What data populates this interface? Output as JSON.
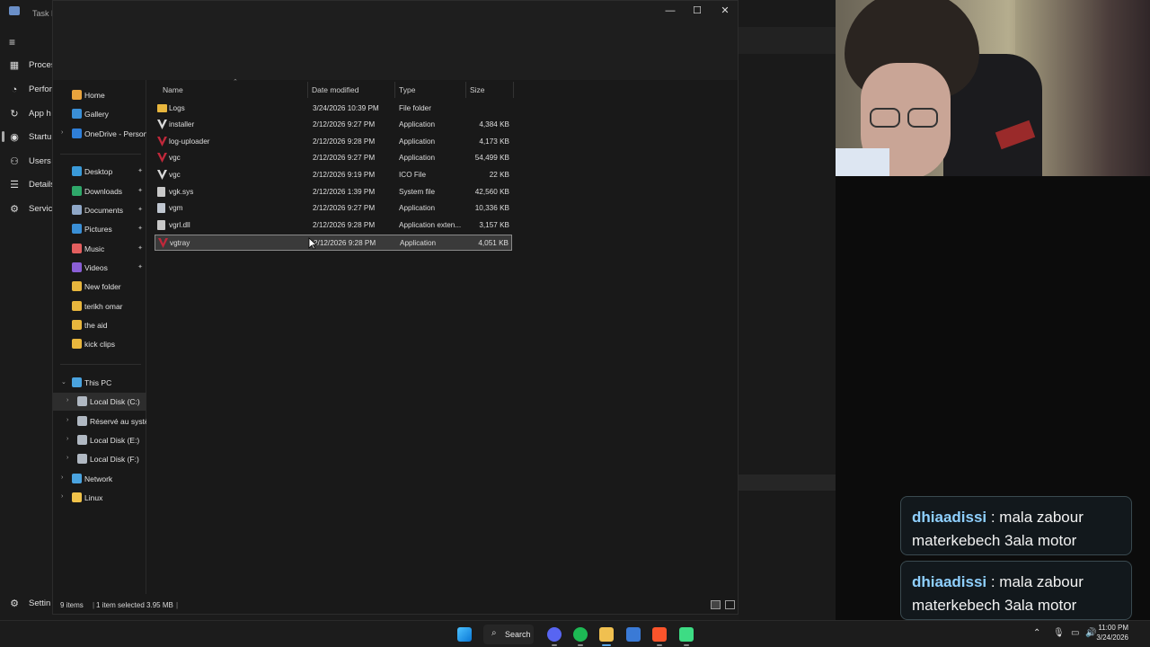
{
  "task_manager": {
    "title": "Task M",
    "nav": [
      {
        "label": "Proces",
        "icon": "processes-icon"
      },
      {
        "label": "Perfor",
        "icon": "performance-icon"
      },
      {
        "label": "App h",
        "icon": "app-history-icon"
      },
      {
        "label": "Startu",
        "icon": "startup-icon"
      },
      {
        "label": "Users",
        "icon": "users-icon"
      },
      {
        "label": "Details",
        "icon": "details-icon"
      },
      {
        "label": "Servic",
        "icon": "services-icon"
      }
    ],
    "settings_label": "Settin"
  },
  "explorer": {
    "window_controls": {
      "minimize": "—",
      "maximize": "☐",
      "close": "✕"
    },
    "nav_pane": {
      "quick": [
        {
          "label": "Home",
          "icon": "home-icon",
          "color": "#e8a33d"
        },
        {
          "label": "Gallery",
          "icon": "gallery-icon",
          "color": "#3a8fd6"
        },
        {
          "label": "OneDrive - Persona",
          "icon": "onedrive-icon",
          "color": "#2f7fd8"
        }
      ],
      "pinned": [
        {
          "label": "Desktop",
          "icon": "desktop-icon",
          "color": "#3a9ad9"
        },
        {
          "label": "Downloads",
          "icon": "downloads-icon",
          "color": "#2fa86a"
        },
        {
          "label": "Documents",
          "icon": "documents-icon",
          "color": "#8fa7c7"
        },
        {
          "label": "Pictures",
          "icon": "pictures-icon",
          "color": "#3a8fd6"
        },
        {
          "label": "Music",
          "icon": "music-icon",
          "color": "#e35f5f"
        },
        {
          "label": "Videos",
          "icon": "videos-icon",
          "color": "#8a5fd6"
        },
        {
          "label": "New folder",
          "icon": "folder-icon",
          "color": "#e8b63d"
        },
        {
          "label": "terikh omar",
          "icon": "folder-icon",
          "color": "#e8b63d"
        },
        {
          "label": "the aid",
          "icon": "folder-icon",
          "color": "#e8b63d"
        },
        {
          "label": "kick clips",
          "icon": "folder-icon",
          "color": "#e8b63d"
        }
      ],
      "this_pc": {
        "label": "This PC",
        "icon": "this-pc-icon"
      },
      "drives": [
        {
          "label": "Local Disk (C:)",
          "icon": "drive-icon"
        },
        {
          "label": "Réservé au systèr",
          "icon": "drive-icon"
        },
        {
          "label": "Local Disk (E:)",
          "icon": "drive-icon"
        },
        {
          "label": "Local Disk (F:)",
          "icon": "drive-icon"
        }
      ],
      "network": {
        "label": "Network",
        "icon": "network-icon"
      },
      "linux": {
        "label": "Linux",
        "icon": "linux-icon"
      }
    },
    "columns": {
      "name": "Name",
      "date": "Date modified",
      "type": "Type",
      "size": "Size"
    },
    "files": [
      {
        "name": "Logs",
        "date": "3/24/2026 10:39 PM",
        "type": "File folder",
        "size": "",
        "icon": "folder-icon"
      },
      {
        "name": "installer",
        "date": "2/12/2026 9:27 PM",
        "type": "Application",
        "size": "4,384 KB",
        "icon": "vanguard-app-icon"
      },
      {
        "name": "log-uploader",
        "date": "2/12/2026 9:28 PM",
        "type": "Application",
        "size": "4,173 KB",
        "icon": "vanguard-red-icon"
      },
      {
        "name": "vgc",
        "date": "2/12/2026 9:27 PM",
        "type": "Application",
        "size": "54,499 KB",
        "icon": "vanguard-red-icon"
      },
      {
        "name": "vgc",
        "date": "2/12/2026 9:19 PM",
        "type": "ICO File",
        "size": "22 KB",
        "icon": "vanguard-app-icon"
      },
      {
        "name": "vgk.sys",
        "date": "2/12/2026 1:39 PM",
        "type": "System file",
        "size": "42,560 KB",
        "icon": "system-file-icon"
      },
      {
        "name": "vgm",
        "date": "2/12/2026 9:27 PM",
        "type": "Application",
        "size": "10,336 KB",
        "icon": "app-window-icon"
      },
      {
        "name": "vgrl.dll",
        "date": "2/12/2026 9:28 PM",
        "type": "Application exten...",
        "size": "3,157 KB",
        "icon": "dll-file-icon"
      },
      {
        "name": "vgtray",
        "date": "2/12/2026 9:28 PM",
        "type": "Application",
        "size": "4,051 KB",
        "icon": "vanguard-red-icon"
      }
    ],
    "status": {
      "items": "9 items",
      "selected": "1 item selected  3.95 MB"
    }
  },
  "chat": [
    {
      "user": "dhiaadissi",
      "message": " : mala zabour materkebech 3ala motor"
    },
    {
      "user": "dhiaadissi",
      "message": " : mala zabour materkebech 3ala motor"
    }
  ],
  "taskbar": {
    "search_label": "Search",
    "time": "11:00 PM",
    "date": "3/24/2026",
    "apps": [
      "windows-start-icon",
      "discord-icon",
      "spotify-icon",
      "file-explorer-icon",
      "snipping-icon",
      "brave-icon",
      "android-studio-icon"
    ]
  }
}
